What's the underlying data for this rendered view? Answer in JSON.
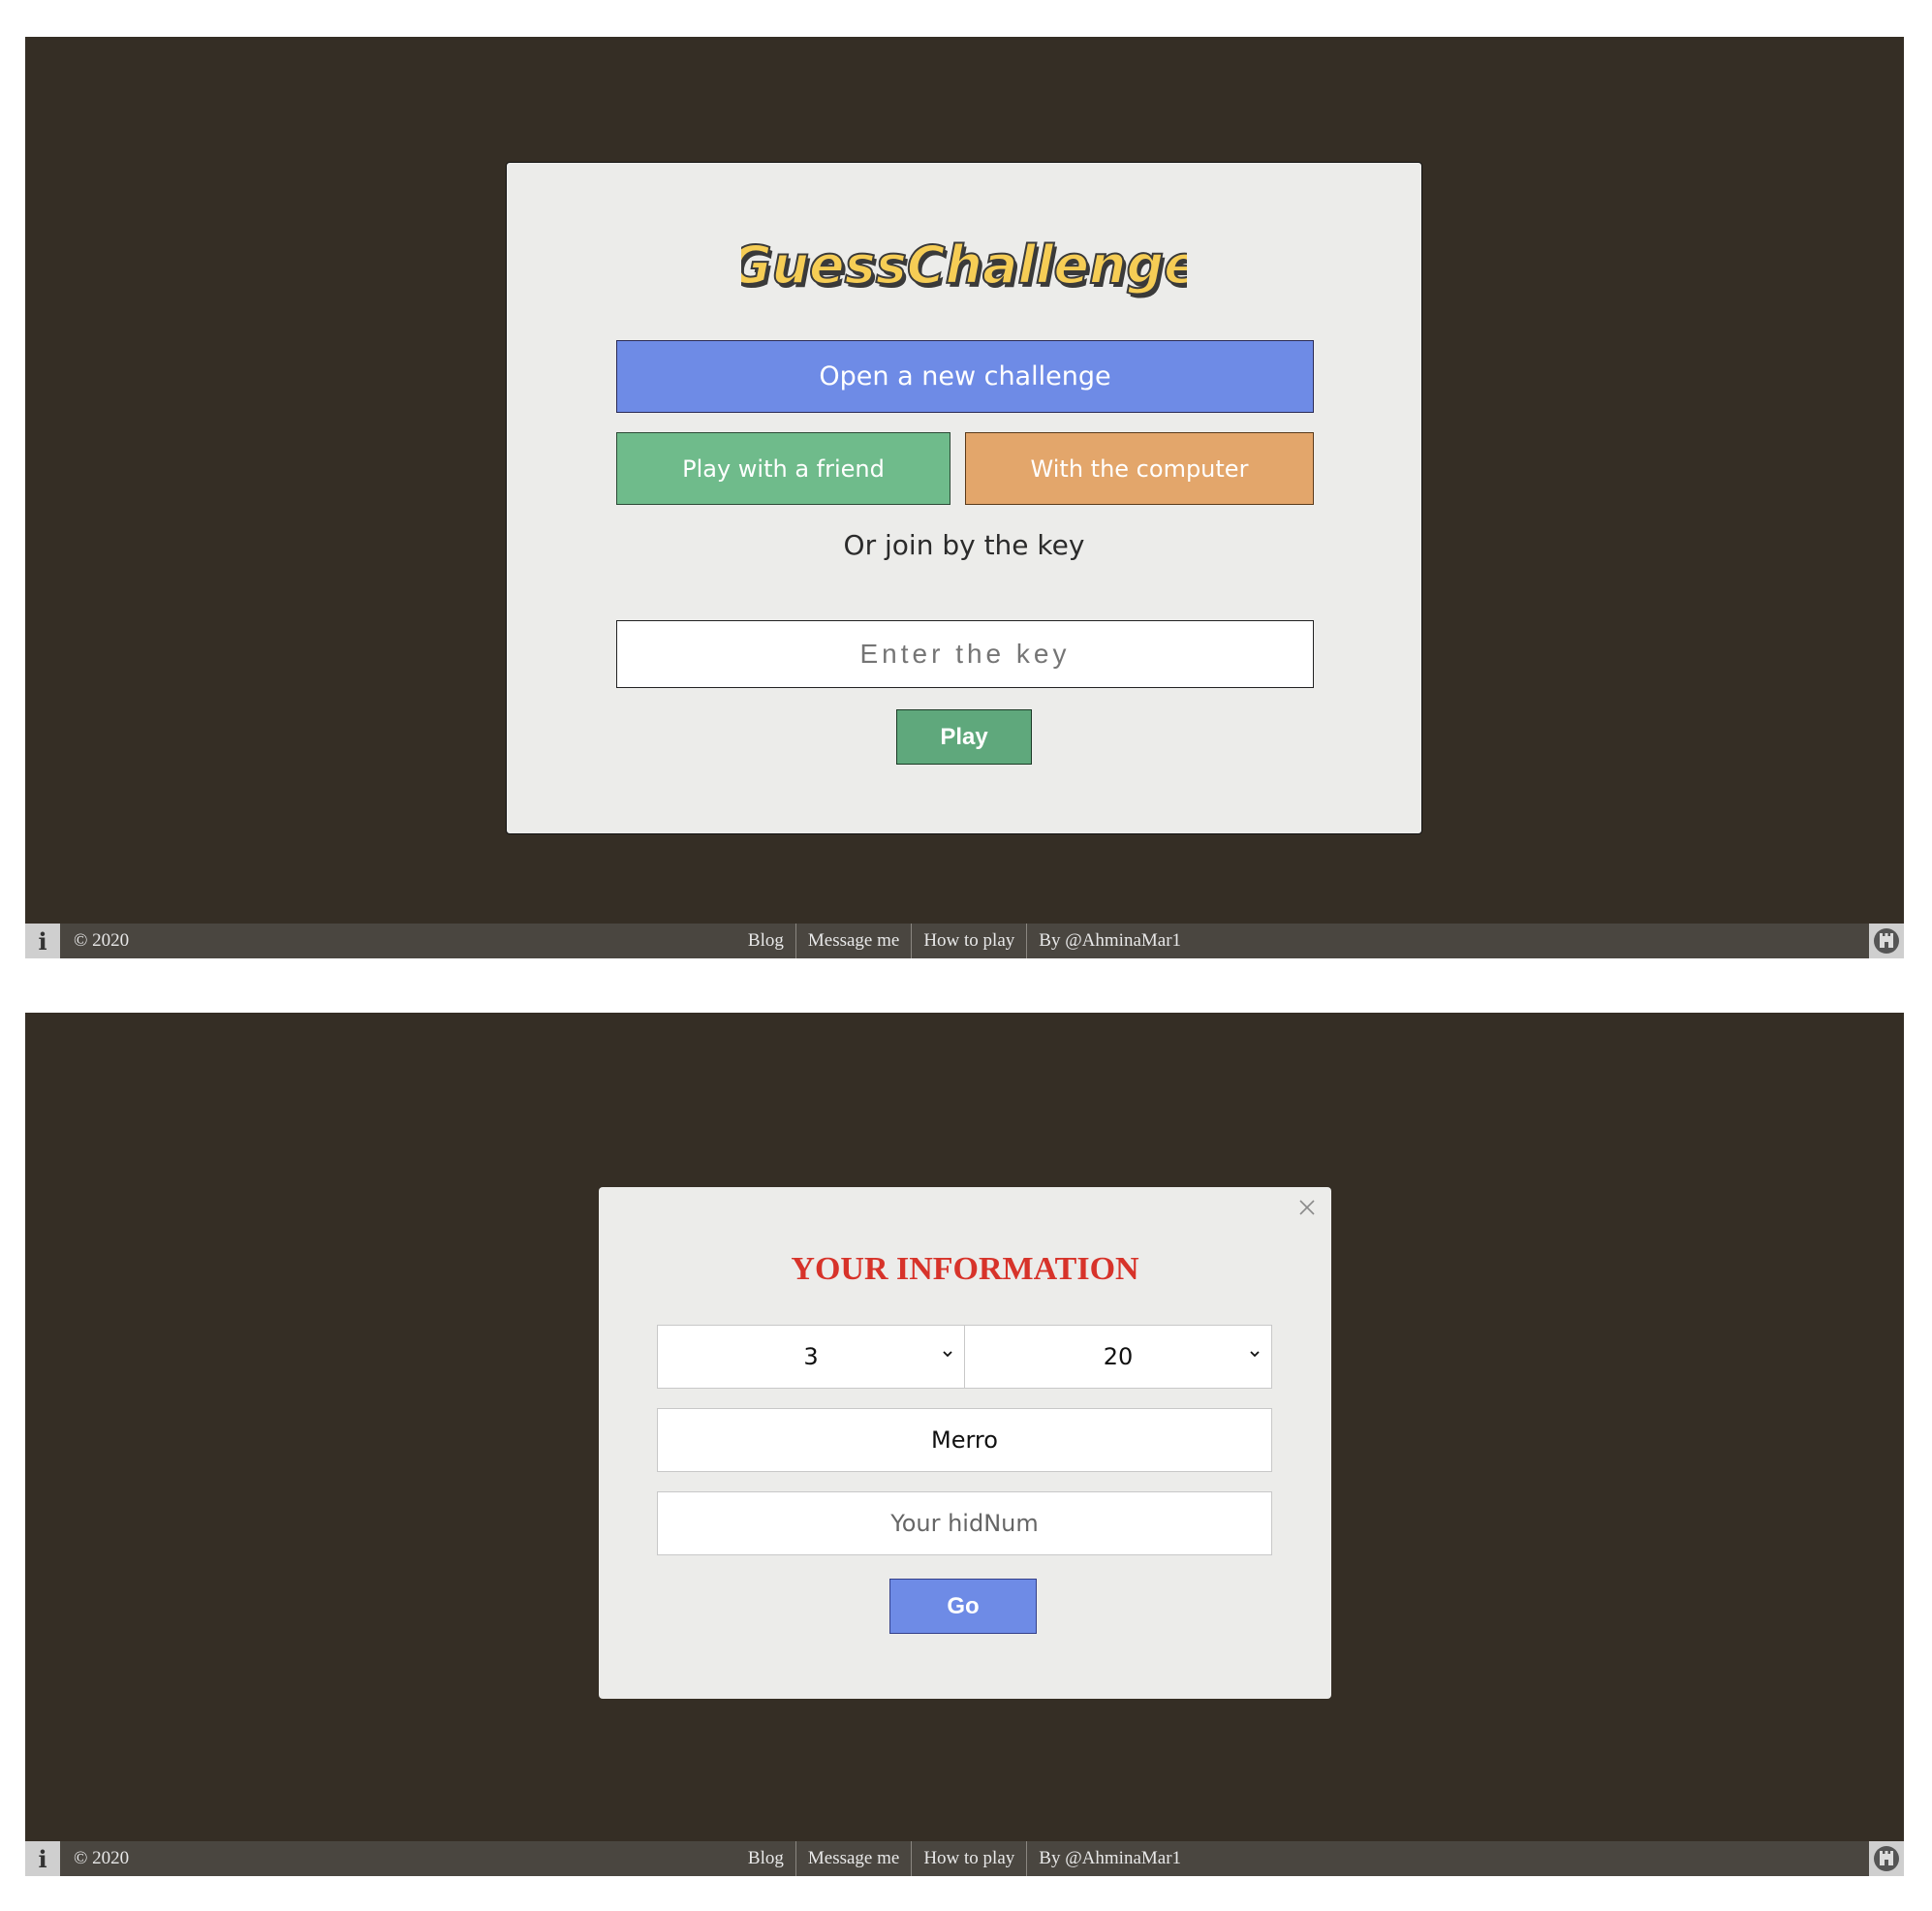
{
  "screen1": {
    "logo_text": "GuessChallenge",
    "open_challenge_label": "Open a new challenge",
    "play_friend_label": "Play with a friend",
    "with_computer_label": "With the computer",
    "join_text": "Or join by the key",
    "key_placeholder": "Enter the key",
    "play_label": "Play"
  },
  "modal": {
    "title": "YOUR INFORMATION",
    "select_digits_value": "3",
    "select_tries_value": "20",
    "name_value": "Merro",
    "hidnum_placeholder": "Your hidNum",
    "go_label": "Go"
  },
  "footer": {
    "copyright": "© 2020",
    "links": [
      "Blog",
      "Message me",
      "How to play",
      "By @AhminaMar1"
    ]
  },
  "colors": {
    "background": "#352e25",
    "card": "#ececea",
    "blue": "#6e8be6",
    "green": "#6fbb8b",
    "orange": "#e3a66b",
    "play_green": "#5fa87c",
    "title_red": "#d7332a",
    "logo_yellow": "#f6cd55"
  },
  "icons": [
    "info-icon",
    "castle-icon",
    "close-icon",
    "chevron-down-icon"
  ]
}
